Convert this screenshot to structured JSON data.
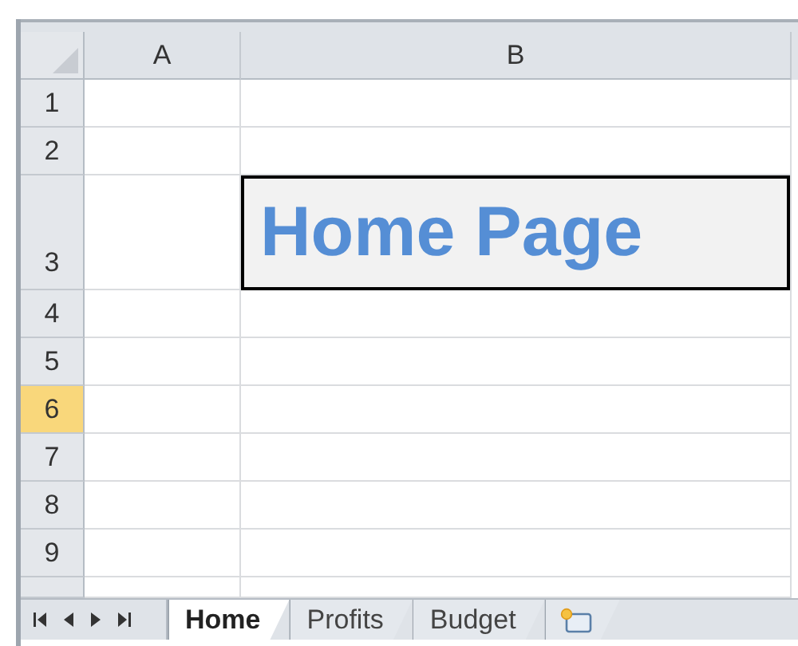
{
  "columns": [
    {
      "label": "A",
      "selected": false
    },
    {
      "label": "B",
      "selected": false
    }
  ],
  "rows": [
    {
      "label": "1",
      "selected": false,
      "kind": "normal"
    },
    {
      "label": "2",
      "selected": false,
      "kind": "normal"
    },
    {
      "label": "3",
      "selected": false,
      "kind": "title",
      "title": "Home Page"
    },
    {
      "label": "4",
      "selected": false,
      "kind": "normal"
    },
    {
      "label": "5",
      "selected": false,
      "kind": "normal"
    },
    {
      "label": "6",
      "selected": true,
      "kind": "normal"
    },
    {
      "label": "7",
      "selected": false,
      "kind": "normal"
    },
    {
      "label": "8",
      "selected": false,
      "kind": "normal"
    },
    {
      "label": "9",
      "selected": false,
      "kind": "normal"
    }
  ],
  "sheet_tabs": [
    {
      "label": "Home",
      "selected": true
    },
    {
      "label": "Profits",
      "selected": false
    },
    {
      "label": "Budget",
      "selected": false
    }
  ]
}
